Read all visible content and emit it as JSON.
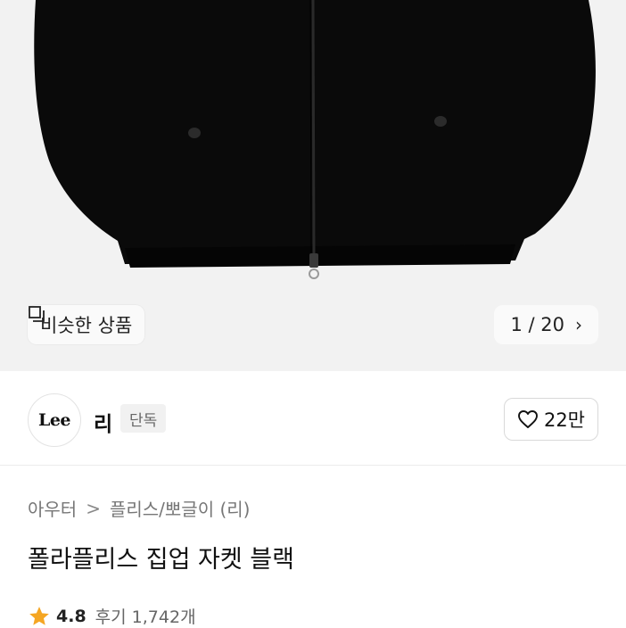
{
  "gallery": {
    "similar_label": "비슷한 상품",
    "counter": "1 / 20",
    "chevron": "›"
  },
  "brand": {
    "logo_text": "Lee",
    "name": "리",
    "badge": "단독",
    "likes": "22만"
  },
  "product": {
    "breadcrumb": [
      "아우터",
      "플리스/뽀글이 (리)"
    ],
    "breadcrumb_sep": ">",
    "title": "폴라플리스 집업 자켓 블랙",
    "rating": "4.8",
    "reviews": "후기 1,742개"
  },
  "colors": {
    "star": "#f5a623",
    "hero_bg": "#f2f2f2",
    "jacket": "#0a0a0a"
  }
}
